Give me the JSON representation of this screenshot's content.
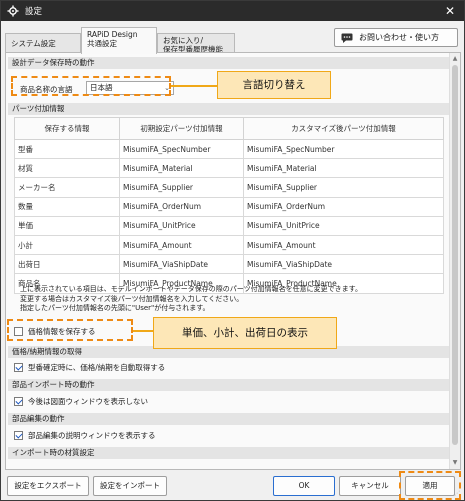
{
  "window": {
    "title": "設定",
    "close_symbol": "✕"
  },
  "tabs": [
    {
      "label1": "システム設定",
      "label2": ""
    },
    {
      "label1": "RAPiD Design",
      "label2": "共通設定"
    },
    {
      "label1": "お気に入り/",
      "label2": "保存型番履歴機能"
    }
  ],
  "help_button": {
    "label": "お問い合わせ・使い方",
    "icon": "chat-icon"
  },
  "sections": {
    "design_save": "設計データ保存時の動作",
    "parts_info": "パーツ付加情報",
    "price_delivery": "価格/納期情報の取得",
    "parts_import": "部品インポート時の動作",
    "parts_edit": "部品編集の動作",
    "import_material": "インポート時の材質設定"
  },
  "language": {
    "label": "商品名称の言語",
    "value": "日本語"
  },
  "table": {
    "headers": [
      "保存する情報",
      "初期設定パーツ付加情報",
      "カスタマイズ後パーツ付加情報"
    ],
    "rows": [
      [
        "型番",
        "MisumiFA_SpecNumber",
        "MisumiFA_SpecNumber"
      ],
      [
        "材質",
        "MisumiFA_Material",
        "MisumiFA_Material"
      ],
      [
        "メーカー名",
        "MisumiFA_Supplier",
        "MisumiFA_Supplier"
      ],
      [
        "数量",
        "MisumiFA_OrderNum",
        "MisumiFA_OrderNum"
      ],
      [
        "単価",
        "MisumiFA_UnitPrice",
        "MisumiFA_UnitPrice"
      ],
      [
        "小計",
        "MisumiFA_Amount",
        "MisumiFA_Amount"
      ],
      [
        "出荷日",
        "MisumiFA_ViaShipDate",
        "MisumiFA_ViaShipDate"
      ],
      [
        "商品名",
        "MisumiFA_ProductName",
        "MisumiFA_ProductName"
      ]
    ]
  },
  "notes": [
    "上に表示されている項目は、モデルインポートやデータ保存の際のパーツ付加情報名を任意に変更できます。",
    "変更する場合はカスタマイズ後パーツ付加情報名を入力してください。",
    "指定したパーツ付加情報名の先頭に\"User\"が付与されます。"
  ],
  "checkboxes": {
    "save_price": {
      "label": "価格情報を保存する",
      "checked": false
    },
    "auto_fetch": {
      "label": "型番確定時に、価格/納期を自動取得する",
      "checked": true
    },
    "hide_drawing": {
      "label": "今後は図面ウィンドウを表示しない",
      "checked": true
    },
    "show_desc": {
      "label": "部品編集の説明ウィンドウを表示する",
      "checked": true
    }
  },
  "callouts": {
    "language": "言語切り替え",
    "display": "単価、小計、出荷日の表示"
  },
  "footer": {
    "export": "設定をエクスポート",
    "import": "設定をインポート",
    "ok": "OK",
    "cancel": "キャンセル",
    "apply": "適用"
  },
  "colors": {
    "accent_orange": "#ee8a14",
    "callout_fill": "#fde7b7",
    "titlebar": "#2b2b2b"
  }
}
